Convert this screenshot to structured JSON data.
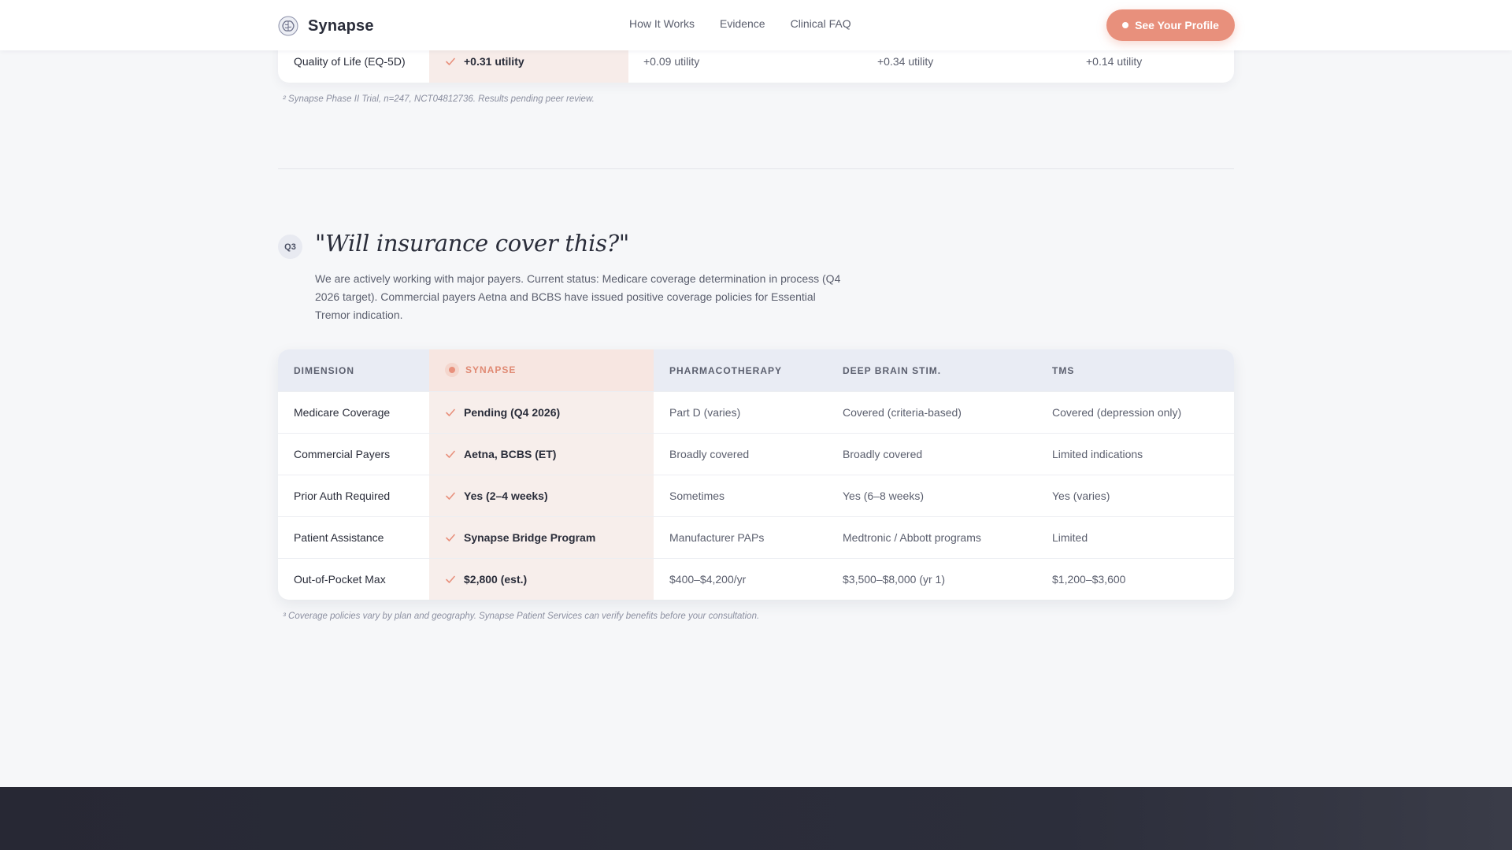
{
  "nav": {
    "brand": "Synapse",
    "links": [
      "How It Works",
      "Evidence",
      "Clinical FAQ"
    ],
    "cta": "See Your Profile"
  },
  "prev_table": {
    "row": {
      "dimension": "Quality of Life (EQ-5D)",
      "synapse": "+0.31 utility",
      "pharmacotherapy": "+0.09 utility",
      "dbs": "+0.34 utility",
      "tms": "+0.14 utility"
    },
    "footnote": "² Synapse Phase II Trial, n=247, NCT04812736. Results pending peer review."
  },
  "q3": {
    "badge": "Q3",
    "title": "\"Will insurance cover this?\"",
    "body": "We are actively working with major payers. Current status: Medicare coverage determination in process (Q4 2026 target). Commercial payers Aetna and BCBS have issued positive coverage policies for Essential Tremor indication."
  },
  "table": {
    "headers": [
      "DIMENSION",
      "SYNAPSE",
      "PHARMACOTHERAPY",
      "DEEP BRAIN STIM.",
      "TMS"
    ],
    "rows": [
      {
        "dimension": "Medicare Coverage",
        "synapse": "Pending (Q4 2026)",
        "pharmacotherapy": "Part D (varies)",
        "dbs": "Covered (criteria-based)",
        "tms": "Covered (depression only)"
      },
      {
        "dimension": "Commercial Payers",
        "synapse": "Aetna, BCBS (ET)",
        "pharmacotherapy": "Broadly covered",
        "dbs": "Broadly covered",
        "tms": "Limited indications"
      },
      {
        "dimension": "Prior Auth Required",
        "synapse": "Yes (2–4 weeks)",
        "pharmacotherapy": "Sometimes",
        "dbs": "Yes (6–8 weeks)",
        "tms": "Yes (varies)"
      },
      {
        "dimension": "Patient Assistance",
        "synapse": "Synapse Bridge Program",
        "pharmacotherapy": "Manufacturer PAPs",
        "dbs": "Medtronic / Abbott programs",
        "tms": "Limited"
      },
      {
        "dimension": "Out-of-Pocket Max",
        "synapse": "$2,800 (est.)",
        "pharmacotherapy": "$400–$4,200/yr",
        "dbs": "$3,500–$8,000 (yr 1)",
        "tms": "$1,200–$3,600"
      }
    ],
    "footnote": "³ Coverage policies vary by plan and geography. Synapse Patient Services can verify benefits before your consultation."
  },
  "colors": {
    "accent": "#e8907c",
    "highlight": "#f7eeeb",
    "header_bg": "#e9ecf4",
    "footer_bg": "#2c2e3b"
  }
}
